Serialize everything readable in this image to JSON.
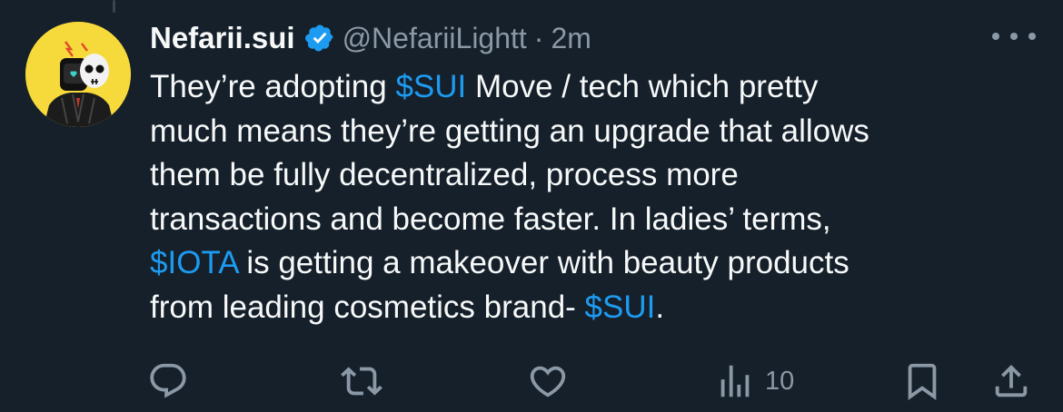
{
  "tweet": {
    "author_name": "Nefarii.sui",
    "handle": "@NefariiLightt",
    "separator": "·",
    "time": "2m",
    "lines": [
      [
        {
          "text": "They’re adopting ",
          "tag": false
        },
        {
          "text": "$SUI",
          "tag": true
        },
        {
          "text": " Move / tech which pretty",
          "tag": false
        }
      ],
      [
        {
          "text": "much means they’re getting an upgrade that allows",
          "tag": false
        }
      ],
      [
        {
          "text": "them be fully decentralized, process more",
          "tag": false
        }
      ],
      [
        {
          "text": "transactions and become faster. In ladies’ terms,",
          "tag": false
        }
      ],
      [
        {
          "text": "$IOTA",
          "tag": true
        },
        {
          "text": " is getting a makeover with beauty products",
          "tag": false
        }
      ],
      [
        {
          "text": "from leading cosmetics brand- ",
          "tag": false
        },
        {
          "text": "$SUI",
          "tag": true
        },
        {
          "text": ".",
          "tag": false
        }
      ]
    ]
  },
  "actions": {
    "reply_icon": "reply-icon",
    "retweet_icon": "retweet-icon",
    "like_icon": "like-icon",
    "views_icon": "views-icon",
    "views_count": "10",
    "bookmark_icon": "bookmark-icon",
    "share_icon": "share-icon"
  },
  "colors": {
    "background": "#15202b",
    "text": "#f7f9f9",
    "muted": "#8b98a5",
    "accent": "#1d9bf0",
    "avatar_bg": "#f6d93a"
  }
}
